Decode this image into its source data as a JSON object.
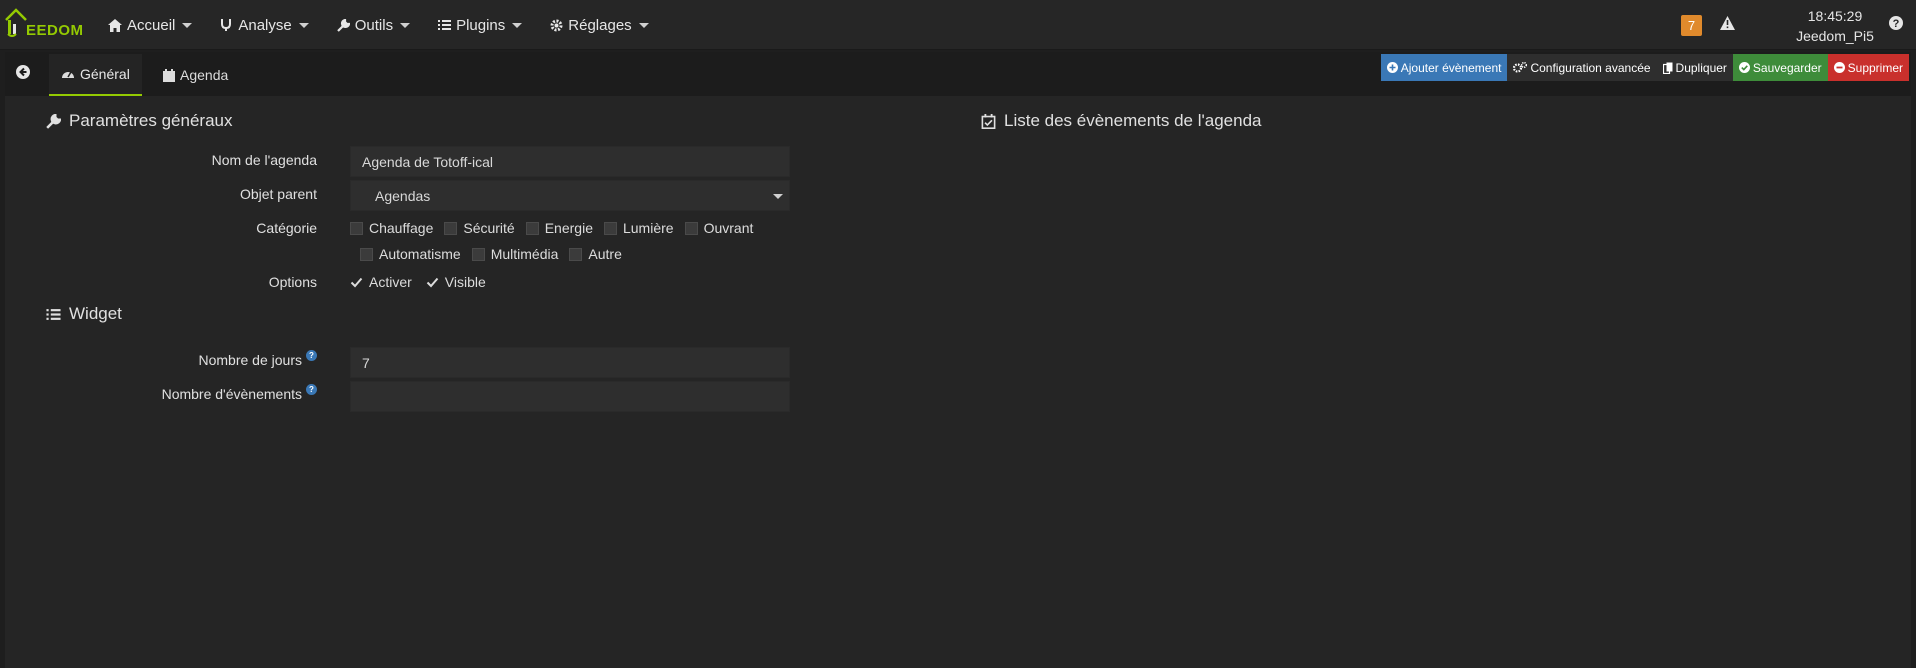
{
  "app": {
    "logo_text": "EEDOM",
    "nav": [
      {
        "label": "Accueil",
        "icon": "home-icon"
      },
      {
        "label": "Analyse",
        "icon": "stethoscope-icon"
      },
      {
        "label": "Outils",
        "icon": "wrench-icon"
      },
      {
        "label": "Plugins",
        "icon": "list-icon"
      },
      {
        "label": "Réglages",
        "icon": "gear-icon"
      }
    ],
    "notification_count": "7",
    "time": "18:45:29",
    "hostname": "Jeedom_Pi5"
  },
  "tabs": {
    "general": "Général",
    "agenda": "Agenda"
  },
  "actions": {
    "add_event": "Ajouter évènement",
    "advanced_config": "Configuration avancée",
    "duplicate": "Dupliquer",
    "save": "Sauvegarder",
    "delete": "Supprimer"
  },
  "general": {
    "title": "Paramètres généraux",
    "name_label": "Nom de l'agenda",
    "name_value": "Agenda de Totoff-ical",
    "parent_label": "Objet parent",
    "parent_value": "Agendas",
    "category_label": "Catégorie",
    "categories_row1": [
      "Chauffage",
      "Sécurité",
      "Energie",
      "Lumière",
      "Ouvrant"
    ],
    "categories_row2": [
      "Automatisme",
      "Multimédia",
      "Autre"
    ],
    "options_label": "Options",
    "option_activate": "Activer",
    "option_visible": "Visible"
  },
  "widget": {
    "title": "Widget",
    "days_label": "Nombre de jours",
    "days_value": "7",
    "events_label": "Nombre d'évènements",
    "events_value": ""
  },
  "events_list": {
    "title": "Liste des évènements de l'agenda"
  },
  "colors": {
    "accent": "#94ca02",
    "blue": "#3a78b6",
    "green": "#3e8c3a",
    "red": "#c9302c",
    "orange": "#e08a2c"
  }
}
